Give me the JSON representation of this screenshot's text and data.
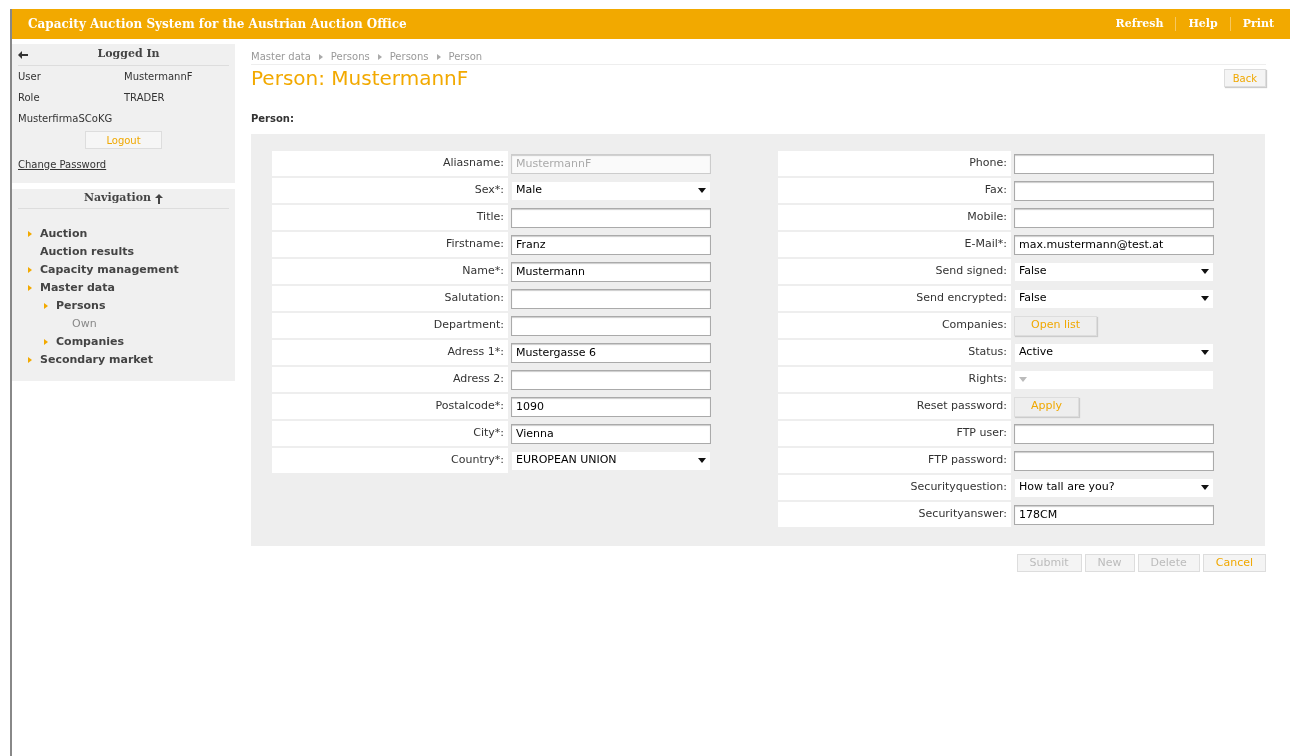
{
  "header": {
    "title": "Capacity Auction System for the Austrian Auction Office",
    "links": [
      "Refresh",
      "Help",
      "Print"
    ]
  },
  "login": {
    "title": "Logged In",
    "rows": [
      {
        "label": "User",
        "value": "MustermannF"
      },
      {
        "label": "Role",
        "value": "TRADER"
      },
      {
        "label": "MusterfirmaSCoKG"
      }
    ],
    "logout": "Logout",
    "change_password": "Change Password"
  },
  "navigation": {
    "title": "Navigation",
    "items": [
      {
        "label": "Auction",
        "marker": true
      },
      {
        "label": "Auction results",
        "marker": false
      },
      {
        "label": "Capacity management",
        "marker": true
      },
      {
        "label": "Master data",
        "marker": true,
        "children": [
          {
            "label": "Persons",
            "marker": true,
            "children": [
              {
                "label": "Own",
                "marker": false
              }
            ]
          },
          {
            "label": "Companies",
            "marker": true
          }
        ]
      },
      {
        "label": "Secondary market",
        "marker": true
      }
    ]
  },
  "breadcrumb": [
    "Master data",
    "Persons",
    "Persons",
    "Person"
  ],
  "page_title": "Person: MustermannF",
  "back": "Back",
  "section_title": "Person:",
  "left_fields": [
    {
      "label": "Aliasname:",
      "kind": "text",
      "value": "MustermannF",
      "disabled": true
    },
    {
      "label": "Sex*:",
      "kind": "select",
      "value": "Male",
      "disabled": false
    },
    {
      "label": "Title:",
      "kind": "text",
      "disabled": false
    },
    {
      "label": "Firstname:",
      "kind": "text",
      "value": "Franz",
      "disabled": false
    },
    {
      "label": "Name*:",
      "kind": "text",
      "value": "Mustermann",
      "disabled": false
    },
    {
      "label": "Salutation:",
      "kind": "text",
      "disabled": false
    },
    {
      "label": "Department:",
      "kind": "text",
      "disabled": false
    },
    {
      "label": "Adress 1*:",
      "kind": "text",
      "value": "Mustergasse 6",
      "disabled": false
    },
    {
      "label": "Adress 2:",
      "kind": "text",
      "disabled": false
    },
    {
      "label": "Postalcode*:",
      "kind": "text",
      "value": "1090",
      "disabled": false
    },
    {
      "label": "City*:",
      "kind": "text",
      "value": "Vienna",
      "disabled": false
    },
    {
      "label": "Country*:",
      "kind": "select",
      "value": "EUROPEAN UNION",
      "disabled": false
    }
  ],
  "right_fields": [
    {
      "label": "Phone:",
      "kind": "text",
      "disabled": false
    },
    {
      "label": "Fax:",
      "kind": "text",
      "disabled": false
    },
    {
      "label": "Mobile:",
      "kind": "text",
      "disabled": false
    },
    {
      "label": "E-Mail*:",
      "kind": "text",
      "value": "max.mustermann@test.at",
      "disabled": false
    },
    {
      "label": "Send signed:",
      "kind": "select",
      "value": "False",
      "disabled": false
    },
    {
      "label": "Send encrypted:",
      "kind": "select",
      "value": "False",
      "disabled": false
    },
    {
      "label": "Companies:",
      "kind": "button",
      "value": "Open list",
      "disabled": false
    },
    {
      "label": "Status:",
      "kind": "select",
      "value": "Active",
      "disabled": false
    },
    {
      "label": "Rights:",
      "kind": "select",
      "disabled": true
    },
    {
      "label": "Reset password:",
      "kind": "button",
      "value": "Apply",
      "disabled": false
    },
    {
      "label": "FTP user:",
      "kind": "text",
      "disabled": false
    },
    {
      "label": "FTP password:",
      "kind": "text",
      "disabled": false
    },
    {
      "label": "Securityquestion:",
      "kind": "select",
      "value": "How tall are you?",
      "disabled": false
    },
    {
      "label": "Securityanswer:",
      "kind": "text",
      "value": "178CM",
      "disabled": false
    }
  ],
  "actions": [
    {
      "label": "Submit",
      "disabled": true
    },
    {
      "label": "New",
      "disabled": true
    },
    {
      "label": "Delete",
      "disabled": true
    },
    {
      "label": "Cancel",
      "disabled": false
    }
  ]
}
